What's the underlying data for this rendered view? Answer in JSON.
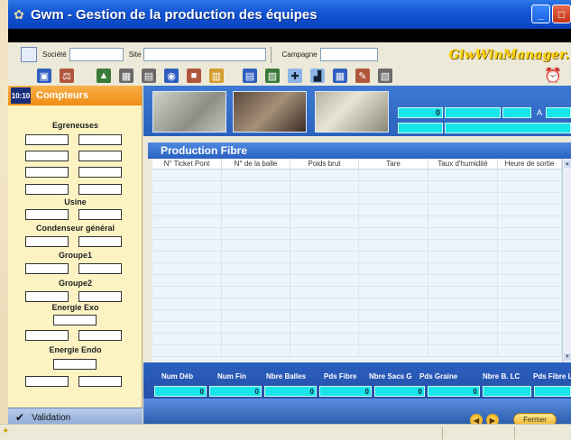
{
  "window": {
    "title": "Gwm - Gestion de la production des équipes",
    "brand": "GiwWinManager."
  },
  "header_fields": {
    "societe_label": "Société",
    "site_label": "Site",
    "campagne_label": "Campagne"
  },
  "left_panel": {
    "clock": "10:10",
    "title": "Compteurs",
    "sections": {
      "egreneuses": "Egreneuses",
      "usine": "Usine",
      "condenseur": "Condenseur général",
      "groupe1": "Groupe1",
      "groupe2": "Groupe2",
      "energie_exo": "Energie Exo",
      "energie_endo": "Energie Endo"
    },
    "validation": "Validation"
  },
  "top_strip": {
    "value1": "0",
    "range_sep": "A"
  },
  "production": {
    "title": "Production Fibre",
    "columns": [
      "N° Ticket Pont",
      "N° de la balle",
      "Poids brut",
      "Tare",
      "Taux d'humidité",
      "Heure de sortie"
    ]
  },
  "totals": {
    "labels": [
      "Num Déb",
      "Num Fin",
      "Nbre Balles",
      "Pds Fibre",
      "Nbre Sacs G",
      "Pds Graine",
      "Nbre B. LC",
      "Pds Fibre LC"
    ],
    "values": [
      "0",
      "0",
      "0",
      "0",
      "0",
      "0"
    ]
  },
  "buttons": {
    "fermer": "Fermer"
  },
  "icons": {
    "app": "cotton-icon",
    "toolbar": [
      "monitor-icon",
      "scale-icon",
      "chart-icon",
      "grid-icon",
      "calc-icon",
      "camera-icon",
      "truck-icon",
      "sack-icon",
      "report-icon",
      "image-icon",
      "add-icon",
      "graph-icon",
      "table-icon",
      "edit-icon",
      "export-icon",
      "alarm-icon"
    ]
  }
}
